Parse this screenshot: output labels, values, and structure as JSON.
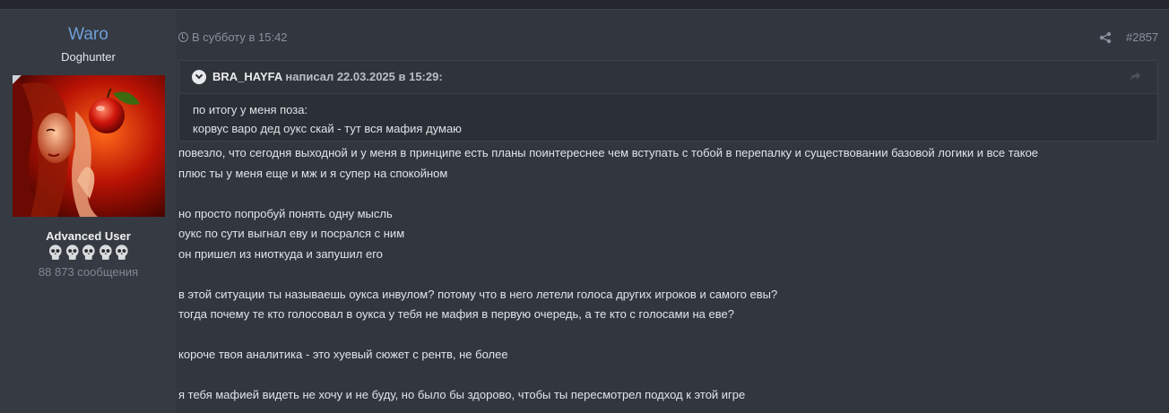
{
  "user": {
    "name": "Waro",
    "title": "Doghunter",
    "rank": "Advanced User",
    "message_count": "88 873 сообщения"
  },
  "post": {
    "date": "В субботу в 15:42",
    "number": "#2857",
    "quote": {
      "author": "BRA_HAYFA",
      "wrote": "написал 22.03.2025 в 15:29:",
      "lines": [
        "по итогу у меня поза:",
        "корвус варо дед оукс скай - тут вся мафия думаю"
      ]
    },
    "body": [
      "повезло, что сегодня выходной и у меня в принципе есть планы поинтереснее чем вступать с тобой в перепалку и существовании базовой логики и все такое",
      "плюс ты у меня еще и мж и я супер на спокойном",
      "",
      "но просто попробуй понять одну мысль",
      "оукс по сути выгнал еву и посрался с ним",
      "он пришел из ниоткуда и запушил его",
      "",
      "в этой ситуации ты называешь оукса инвулом? потому что в него летели голоса других игроков и самого евы?",
      "тогда почему те кто голосовал в оукса у тебя не мафия в первую очередь, а те кто с голосами на еве?",
      "",
      "короче твоя аналитика - это хуевый сюжет с рентв, не более",
      "",
      "я тебя мафией видеть не хочу и не буду, но было бы здорово, чтобы ты пересмотрел подход к этой игре"
    ]
  },
  "colors": {
    "username": "#6e9fdb",
    "background": "#32363e",
    "quote_bg": "#2b2f36"
  },
  "icons": [
    "clock-icon",
    "share-icon",
    "chevron-down-icon",
    "jump-to-quote-icon",
    "skull-icon"
  ]
}
